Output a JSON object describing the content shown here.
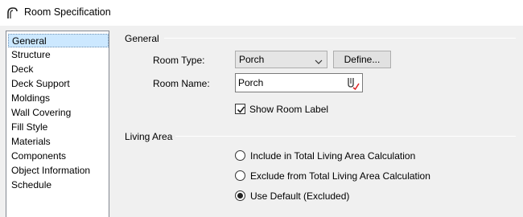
{
  "window": {
    "title": "Room Specification",
    "icon": "arch-icon"
  },
  "sidebar": {
    "items": [
      {
        "label": "General",
        "selected": true
      },
      {
        "label": "Structure",
        "selected": false
      },
      {
        "label": "Deck",
        "selected": false
      },
      {
        "label": "Deck Support",
        "selected": false
      },
      {
        "label": "Moldings",
        "selected": false
      },
      {
        "label": "Wall Covering",
        "selected": false
      },
      {
        "label": "Fill Style",
        "selected": false
      },
      {
        "label": "Materials",
        "selected": false
      },
      {
        "label": "Components",
        "selected": false
      },
      {
        "label": "Object Information",
        "selected": false
      },
      {
        "label": "Schedule",
        "selected": false
      }
    ]
  },
  "general_group": {
    "title": "General",
    "room_type_label": "Room Type:",
    "room_type_value": "Porch",
    "define_button": "Define...",
    "room_name_label": "Room Name:",
    "room_name_value": "Porch",
    "room_name_icon": "text-macro-icon",
    "show_label_text": "Show Room Label",
    "show_label_checked": true
  },
  "living_area_group": {
    "title": "Living Area",
    "options": [
      {
        "label": "Include in Total Living Area Calculation",
        "selected": false
      },
      {
        "label": "Exclude from Total Living Area Calculation",
        "selected": false
      },
      {
        "label": "Use Default (Excluded)",
        "selected": true
      }
    ]
  }
}
